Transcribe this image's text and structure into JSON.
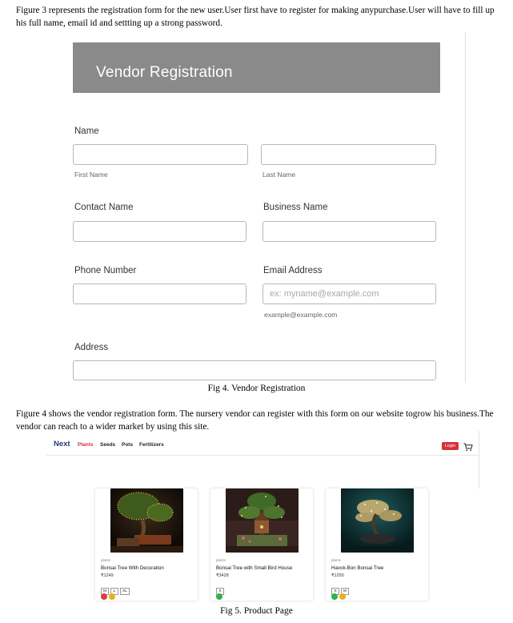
{
  "intro_text": "Figure 3 represents the registration form for the new user.User first have to register for making anypurchase.User will have to fill up his full name, email id and settting up a strong password.",
  "vendor_form": {
    "title": "Vendor Registration",
    "name_label": "Name",
    "first_name_sub": "First Name",
    "last_name_sub": "Last Name",
    "contact_name_label": "Contact Name",
    "business_name_label": "Business Name",
    "phone_label": "Phone Number",
    "email_label": "Email Address",
    "email_placeholder": "ex: myname@example.com",
    "email_sub": "example@example.com",
    "address_label": "Address"
  },
  "caption4": "Fig 4. Vendor Registration",
  "middle_text": "Figure 4 shows the vendor registration form. The nursery vendor can register with this form on our website togrow his business.The vendor can reach to a wider market by using this site.",
  "product_page": {
    "logo": "Next",
    "nav": [
      "Plants",
      "Seeds",
      "Pots",
      "Fertilizers"
    ],
    "login_label": "Login",
    "cart_icon": "cart-icon",
    "colors": {
      "accent": "#d6303b",
      "red_dot": "#e0394a",
      "yellow_dot": "#e8b020",
      "green_dot": "#2fb34a"
    },
    "products": [
      {
        "category": "plants",
        "name": "Bonsai Tree With Decoration",
        "price": "₹1249",
        "sizes": [
          "M",
          "L",
          "XL"
        ],
        "colors": [
          "red",
          "yellow"
        ]
      },
      {
        "category": "plants",
        "name": "Bonsai Tree with Small Bird House",
        "price": "₹3428",
        "sizes": [
          "S"
        ],
        "colors": [
          "green"
        ]
      },
      {
        "category": "plants",
        "name": "Havok-Bon Bonsai Tree",
        "price": "₹1250",
        "sizes": [
          "S",
          "M"
        ],
        "colors": [
          "green",
          "yellow"
        ]
      }
    ]
  },
  "caption5": "Fig 5. Product Page"
}
